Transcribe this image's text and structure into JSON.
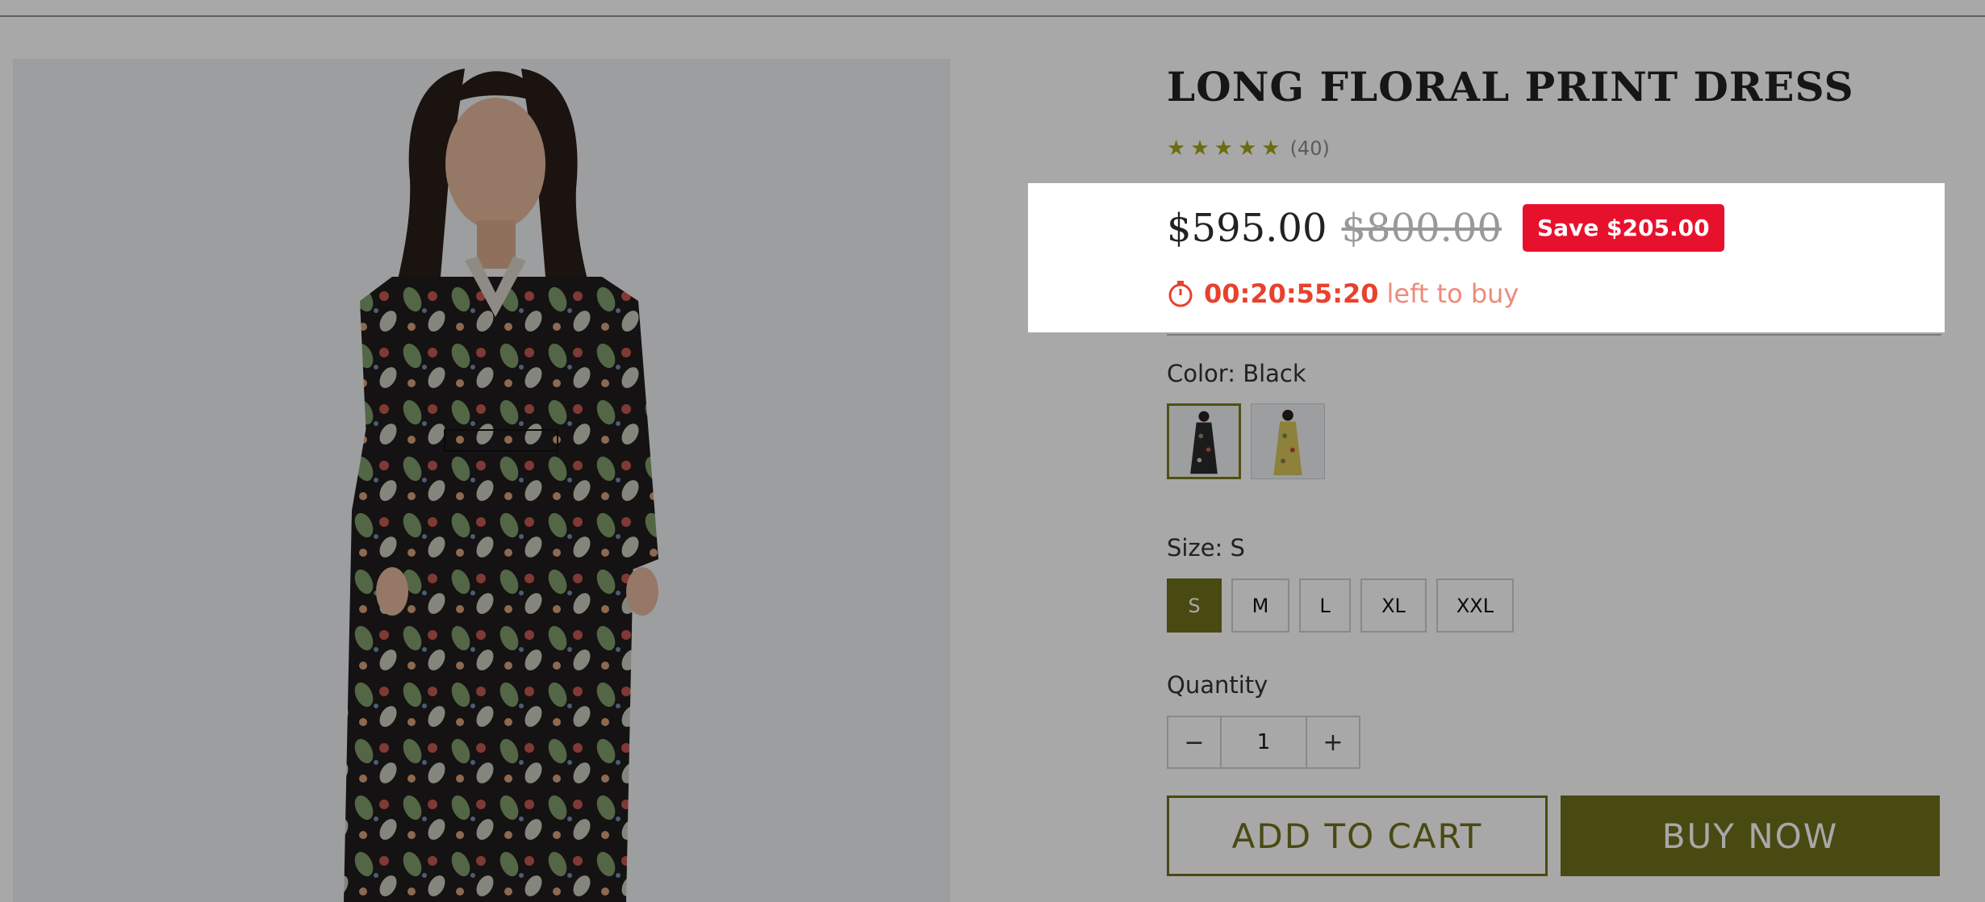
{
  "product": {
    "title": "LONG FLORAL PRINT DRESS",
    "rating": {
      "stars": 5,
      "count_text": "(40)",
      "star_glyph": "★",
      "star_color": "#a3a518"
    },
    "price": "$595.00",
    "compare_price": "$800.00",
    "save_badge": "Save $205.00",
    "timer": {
      "time": "00:20:55:20",
      "suffix": "left to buy"
    },
    "color": {
      "label": "Color: Black",
      "options": [
        "Black",
        "Yellow"
      ]
    },
    "size": {
      "label": "Size: S",
      "options": [
        "S",
        "M",
        "L",
        "XL",
        "XXL"
      ],
      "selected": "S"
    },
    "quantity": {
      "label": "Quantity",
      "minus": "−",
      "value": "1",
      "plus": "+"
    },
    "buttons": {
      "add_to_cart": "ADD TO CART",
      "buy_now": "BUY NOW"
    }
  },
  "colors": {
    "accent": "#6f6f1c",
    "badge": "#e8112d",
    "timer": "#e8412d"
  }
}
